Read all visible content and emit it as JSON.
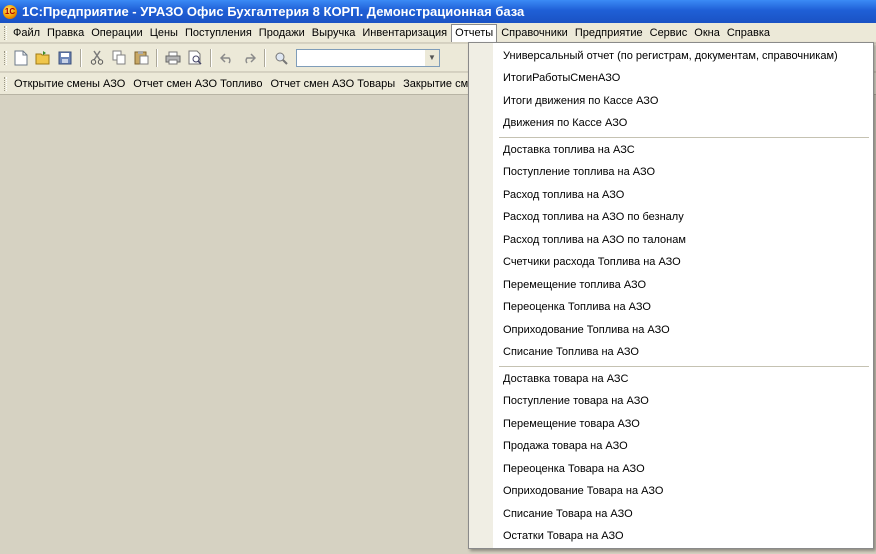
{
  "window": {
    "title": "1С:Предприятие - УРАЗО Офис Бухгалтерия 8 КОРП. Демонстрационная база"
  },
  "menubar": {
    "items": [
      {
        "label": "Файл"
      },
      {
        "label": "Правка"
      },
      {
        "label": "Операции"
      },
      {
        "label": "Цены"
      },
      {
        "label": "Поступления"
      },
      {
        "label": "Продажи"
      },
      {
        "label": "Выручка"
      },
      {
        "label": "Инвентаризация"
      },
      {
        "label": "Отчеты"
      },
      {
        "label": "Справочники"
      },
      {
        "label": "Предприятие"
      },
      {
        "label": "Сервис"
      },
      {
        "label": "Окна"
      },
      {
        "label": "Справка"
      }
    ]
  },
  "toolbar": {
    "icons": [
      "new-document-icon",
      "open-folder-icon",
      "save-icon",
      "cut-icon",
      "copy-icon",
      "paste-icon",
      "print-icon",
      "print-preview-icon",
      "undo-icon",
      "redo-icon",
      "search-icon"
    ],
    "search_value": ""
  },
  "quickbar": {
    "items": [
      {
        "label": "Открытие смены АЗО"
      },
      {
        "label": "Отчет смен АЗО Топливо"
      },
      {
        "label": "Отчет смен АЗО Товары"
      },
      {
        "label": "Закрытие см"
      }
    ]
  },
  "reports_menu": {
    "group1": [
      {
        "label": "Универсальный отчет (по регистрам, документам, справочникам)"
      },
      {
        "label": "ИтогиРаботыСменАЗО"
      },
      {
        "label": " Итоги движения по Кассе АЗО"
      },
      {
        "label": "Движения по Кассе АЗО"
      }
    ],
    "group2": [
      {
        "label": "Доставка топлива на  АЗС"
      },
      {
        "label": "Поступление топлива на  АЗО"
      },
      {
        "label": "Расход топлива на  АЗО"
      },
      {
        "label": "Расход топлива на  АЗО по безналу"
      },
      {
        "label": "Расход топлива на  АЗО по талонам"
      },
      {
        "label": "Счетчики расхода Топлива  на  АЗО"
      },
      {
        "label": "Перемещение топлива  АЗО"
      },
      {
        "label": "Переоценка Топлива  на  АЗО"
      },
      {
        "label": "Оприходование Топлива  на  АЗО"
      },
      {
        "label": "Списание Топлива  на  АЗО"
      }
    ],
    "group3": [
      {
        "label": "Доставка товара на  АЗС"
      },
      {
        "label": "Поступление товара на  АЗО"
      },
      {
        "label": "Перемещение товара  АЗО"
      },
      {
        "label": "Продажа товара на  АЗО"
      },
      {
        "label": "Переоценка Товара  на  АЗО"
      },
      {
        "label": "Оприходование Товара  на  АЗО"
      },
      {
        "label": "Списание Товара  на  АЗО"
      },
      {
        "label": "Остатки Товара  на  АЗО"
      }
    ]
  }
}
